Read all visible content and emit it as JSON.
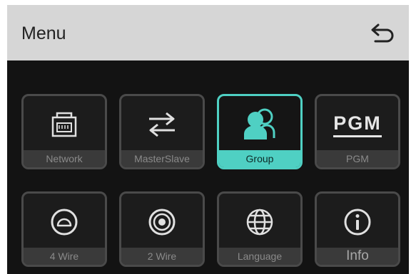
{
  "header": {
    "title": "Menu",
    "back_icon": "return-arrow-icon"
  },
  "colors": {
    "accent": "#4fd0c3",
    "background": "#131313",
    "header": "#d6d6d6"
  },
  "tiles": [
    {
      "label": "Network",
      "icon": "ethernet-port-icon",
      "selected": false
    },
    {
      "label": "MasterSlave",
      "icon": "swap-arrows-icon",
      "selected": false
    },
    {
      "label": "Group",
      "icon": "group-users-icon",
      "selected": true
    },
    {
      "label": "PGM",
      "icon_text": "PGM",
      "selected": false
    },
    {
      "label": "4 Wire",
      "icon": "circle-connector-icon",
      "selected": false
    },
    {
      "label": "2 Wire",
      "icon": "xlr-connector-icon",
      "selected": false
    },
    {
      "label": "Language",
      "icon": "globe-icon",
      "selected": false
    },
    {
      "label": "Info",
      "icon": "info-icon",
      "selected": false
    }
  ]
}
